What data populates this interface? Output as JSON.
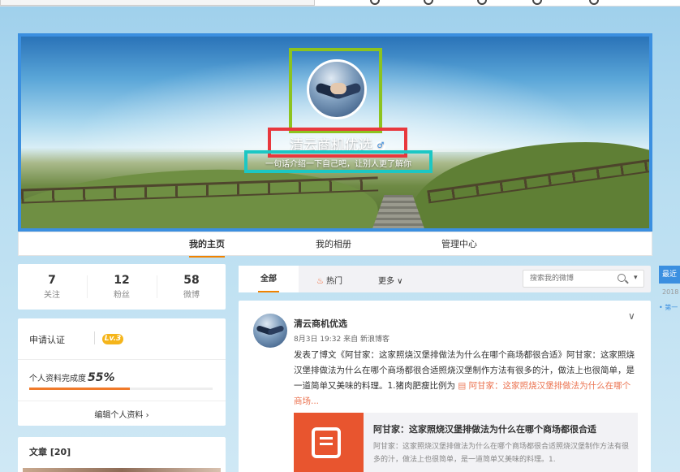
{
  "profile": {
    "name": "清云商机优选",
    "gender_icon": "male-icon",
    "intro": "一句话介绍一下自己吧，让别人更了解你"
  },
  "nav": {
    "tabs": [
      {
        "label": "我的主页",
        "active": true
      },
      {
        "label": "我的相册",
        "active": false
      },
      {
        "label": "管理中心",
        "active": false
      }
    ]
  },
  "stats": [
    {
      "num": "7",
      "label": "关注"
    },
    {
      "num": "12",
      "label": "粉丝"
    },
    {
      "num": "58",
      "label": "微博"
    }
  ],
  "verify": {
    "label": "申请认证",
    "level": "Lv.3",
    "completeness_label": "个人资料完成度",
    "completeness": "55%",
    "completeness_fraction": 0.55,
    "edit_link": "编辑个人资料 ›"
  },
  "articles": {
    "title": "文章 [20]"
  },
  "feed": {
    "tabs": {
      "all": "全部",
      "hot": "热门",
      "more": "更多 ∨"
    },
    "search_placeholder": "搜索我的微博"
  },
  "post": {
    "author": "清云商机优选",
    "meta": "8月3日 19:32 来自 新浪博客",
    "body": "发表了博文《阿甘家：这家照烧汉堡排做法为什么在哪个商场都很合适》阿甘家：这家照烧汉堡排做法为什么在哪个商场都很合适照烧汉堡制作方法有很多的汁，做法上也很简单，是一道简单又美味的料理。1.猪肉肥瘦比例为 ",
    "link": "阿甘家：这家照烧汉堡排做法为什么在哪个商场...",
    "embed_title": "阿甘家：这家照烧汉堡排做法为什么在哪个商场都很合适",
    "embed_desc": "阿甘家：这家照烧汉堡排做法为什么在哪个商场都很合适照烧汉堡制作方法有很多的汁，做法上也很简单，是一道简单又美味的料理。1."
  },
  "right_widget": {
    "header": "最近",
    "year": "2018",
    "item": "• 第一"
  },
  "colors": {
    "accent": "#f08300",
    "link": "#eb7350",
    "avatar_highlight": "#8dc31f",
    "name_highlight": "#e8383d",
    "intro_highlight": "#1cc7c4",
    "cover_border": "#3b8fe0"
  }
}
